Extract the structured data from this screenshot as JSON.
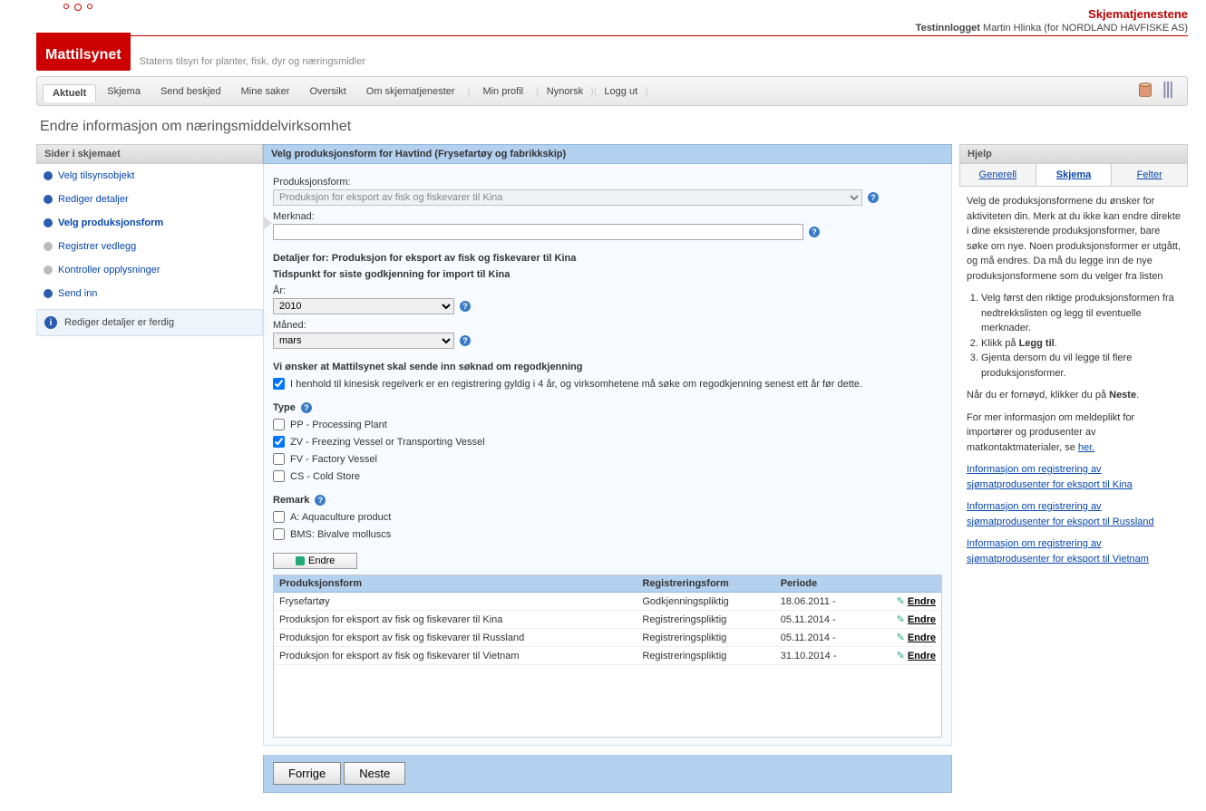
{
  "header": {
    "service_title": "Skjematjenestene",
    "login_label": "Testinnlogget",
    "user": "Martin Hlinka (for NORDLAND HAVFISKE AS)",
    "tagline": "Statens tilsyn for planter, fisk, dyr og næringsmidler",
    "logo_text": "Mattilsynet"
  },
  "tabs": {
    "items": [
      "Aktuelt",
      "Skjema",
      "Send beskjed",
      "Mine saker",
      "Oversikt",
      "Om skjematjenester"
    ],
    "min_profil": "Min profil",
    "nynorsk": "Nynorsk",
    "logout": "Logg ut"
  },
  "page_title": "Endre informasjon om næringsmiddelvirksomhet",
  "sidebar": {
    "title": "Sider i skjemaet",
    "items": [
      {
        "label": "Velg tilsynsobjekt",
        "bullet": "blue"
      },
      {
        "label": "Rediger detaljer",
        "bullet": "blue"
      },
      {
        "label": "Velg produksjonsform",
        "bullet": "blue",
        "current": true
      },
      {
        "label": "Registrer vedlegg",
        "bullet": "gray"
      },
      {
        "label": "Kontroller opplysninger",
        "bullet": "gray"
      },
      {
        "label": "Send inn",
        "bullet": "blue"
      }
    ],
    "info": "Rediger detaljer er ferdig"
  },
  "main": {
    "title": "Velg produksjonsform for Havtind (Frysefartøy og fabrikkskip)",
    "prodform_label": "Produksjonsform:",
    "prodform_value": "Produksjon for eksport av fisk og fiskevarer til Kina",
    "merknad_label": "Merknad:",
    "merknad_value": "",
    "details_title": "Detaljer for: Produksjon for eksport av fisk og fiskevarer til Kina",
    "tidspunkt_title": "Tidspunkt for siste godkjenning for import til Kina",
    "year_label": "År:",
    "year_value": "2010",
    "month_label": "Måned:",
    "month_value": "mars",
    "reapproval_title": "Vi ønsker at Mattilsynet skal sende inn søknad om regodkjenning",
    "reapproval_cb": "I henhold til kinesisk regelverk er en registrering gyldig i 4 år, og virksomhetene må søke om regodkjenning senest ett år før dette.",
    "type_label": "Type",
    "types": [
      {
        "label": "PP - Processing Plant",
        "checked": false
      },
      {
        "label": "ZV - Freezing Vessel or Transporting Vessel",
        "checked": true
      },
      {
        "label": "FV - Factory Vessel",
        "checked": false
      },
      {
        "label": "CS - Cold Store",
        "checked": false
      }
    ],
    "remark_label": "Remark",
    "remarks": [
      {
        "label": "A: Aquaculture product",
        "checked": false
      },
      {
        "label": "BMS: Bivalve molluscs",
        "checked": false
      }
    ],
    "endre_btn": "Endre",
    "table": {
      "col1": "Produksjonsform",
      "col2": "Registreringsform",
      "col3": "Periode",
      "edit": "Endre",
      "rows": [
        {
          "c1": "Frysefartøy",
          "c2": "Godkjenningspliktig",
          "c3": "18.06.2011 -"
        },
        {
          "c1": "Produksjon for eksport av fisk og fiskevarer til Kina",
          "c2": "Registreringspliktig",
          "c3": "05.11.2014 -"
        },
        {
          "c1": "Produksjon for eksport av fisk og fiskevarer til Russland",
          "c2": "Registreringspliktig",
          "c3": "05.11.2014 -"
        },
        {
          "c1": "Produksjon for eksport av fisk og fiskevarer til Vietnam",
          "c2": "Registreringspliktig",
          "c3": "31.10.2014 -"
        }
      ]
    },
    "prev_btn": "Forrige",
    "next_btn": "Neste"
  },
  "help": {
    "title": "Hjelp",
    "tabs": [
      "Generell",
      "Skjema",
      "Felter"
    ],
    "p1": "Velg de produksjonsformene du ønsker for aktiviteten din. Merk at du ikke kan endre direkte i dine eksisterende produksjonsformer, bare søke om nye. Noen produksjonsformer er utgått, og må endres. Da må du legge inn de nye produksjonsformene som du velger fra listen",
    "ol1": "Velg først den riktige produksjonsformen fra nedtrekkslisten og legg til eventuelle merknader.",
    "ol2a": "Klikk på ",
    "ol2b": "Legg til",
    "ol3": "Gjenta dersom du vil legge til flere produksjonsformer.",
    "p2a": "Når du er fornøyd, klikker du på ",
    "p2b": "Neste",
    "p3a": "For mer informasjon om meldeplikt for importører og produsenter av matkontaktmaterialer, se ",
    "p3b": "her.",
    "link1": "Informasjon om registrering av sjømatprodusenter for eksport til Kina",
    "link2": "Informasjon om registrering av sjømatprodusenter for eksport til Russland",
    "link3": "Informasjon om registrering av sjømatprodusenter for eksport til Vietnam"
  }
}
